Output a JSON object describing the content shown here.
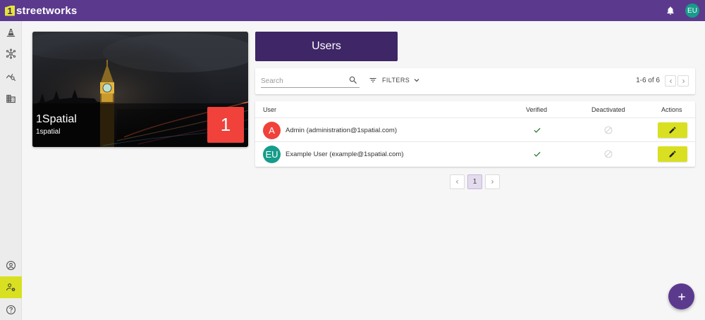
{
  "app": {
    "logo_digit": "1",
    "logo_text": "streetworks"
  },
  "header": {
    "avatar_initials": "EU",
    "icons": [
      "bell-icon"
    ]
  },
  "sidenav": {
    "top_items": [
      "roadworks-cone-icon",
      "network-icon",
      "analytics-icon",
      "organisation-icon"
    ],
    "bottom_items": [
      "account-icon",
      "user-admin-icon",
      "help-icon"
    ],
    "active": "user-admin-icon"
  },
  "project": {
    "title": "1Spatial",
    "subtitle": "1spatial",
    "badge": "1"
  },
  "users_page": {
    "title": "Users",
    "search_placeholder": "Search",
    "filters_label": "FILTERS",
    "range_label": "1-6 of 6"
  },
  "table": {
    "headers": {
      "user": "User",
      "verified": "Verified",
      "deactivated": "Deactivated",
      "actions": "Actions"
    },
    "rows": [
      {
        "initials": "A",
        "label": "Admin (administration@1spatial.com)",
        "verified": true,
        "deactivated": false,
        "avatar_color": "#f0413b"
      },
      {
        "initials": "EU",
        "label": "Example User (example@1spatial.com)",
        "verified": true,
        "deactivated": false,
        "avatar_color": "#169c8a"
      }
    ]
  },
  "pagination": {
    "current_page": "1"
  },
  "colors": {
    "primary": "#5b3a8e",
    "primary_dark": "#3f2666",
    "accent": "#d9e021",
    "badge_red": "#f0413b",
    "teal": "#169c8a"
  }
}
